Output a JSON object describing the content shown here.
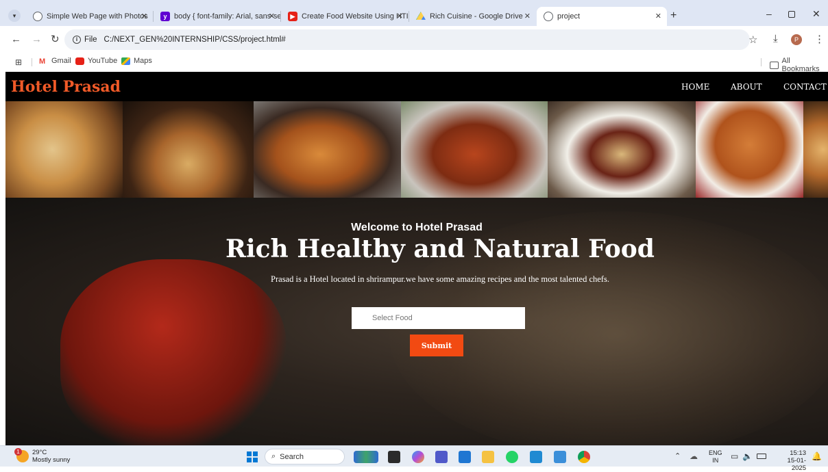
{
  "browser": {
    "tabs": [
      {
        "label": "Simple Web Page with Photos",
        "favicon": "globe-icon",
        "color": "#5f6368"
      },
      {
        "label": "body { font-family: Arial, sans-se",
        "favicon": "yahoo-icon",
        "color": "#6001d2"
      },
      {
        "label": "Create Food Website Using HTI",
        "favicon": "youtube-icon",
        "color": "#e62117"
      },
      {
        "label": "Rich Cuisine - Google Drive",
        "favicon": "drive-icon",
        "color": "#1fa463"
      },
      {
        "label": "project",
        "favicon": "globe-icon",
        "color": "#5f6368",
        "active": true
      }
    ],
    "address": {
      "scheme_label": "File",
      "url": "C:/NEXT_GEN%20INTERNSHIP/CSS/project.html#"
    },
    "bookmarks": [
      {
        "label": "Gmail",
        "icon": "gmail-icon"
      },
      {
        "label": "YouTube",
        "icon": "youtube-icon"
      },
      {
        "label": "Maps",
        "icon": "maps-icon"
      }
    ],
    "all_bookmarks_label": "All Bookmarks",
    "profile_initial": "P"
  },
  "site": {
    "brand": "Hotel Prasad",
    "brand_color": "#f05a28",
    "nav": [
      {
        "label": "HOME"
      },
      {
        "label": "ABOUT"
      },
      {
        "label": "CONTACT"
      }
    ],
    "gallery": [
      "biryani",
      "biryani in bowl",
      "roast chicken in pan",
      "tandoori chicken",
      "stuffed chicken plate",
      "fried chicken",
      "biryani"
    ],
    "hero": {
      "welcome": "Welcome to Hotel Prasad",
      "title": "Rich Healthy and Natural Food",
      "description": "Prasad is a Hotel located in shrirampur.we have some amazing recipes and the most talented chefs.",
      "input_placeholder": "Select Food",
      "submit_label": "Submit",
      "accent": "#f24a12"
    }
  },
  "taskbar": {
    "weather": {
      "temp": "29°C",
      "condition": "Mostly sunny",
      "badge": "1"
    },
    "search_label": "Search",
    "lang_top": "ENG",
    "lang_bottom": "IN",
    "time": "15:13",
    "date": "15-01-2025"
  }
}
